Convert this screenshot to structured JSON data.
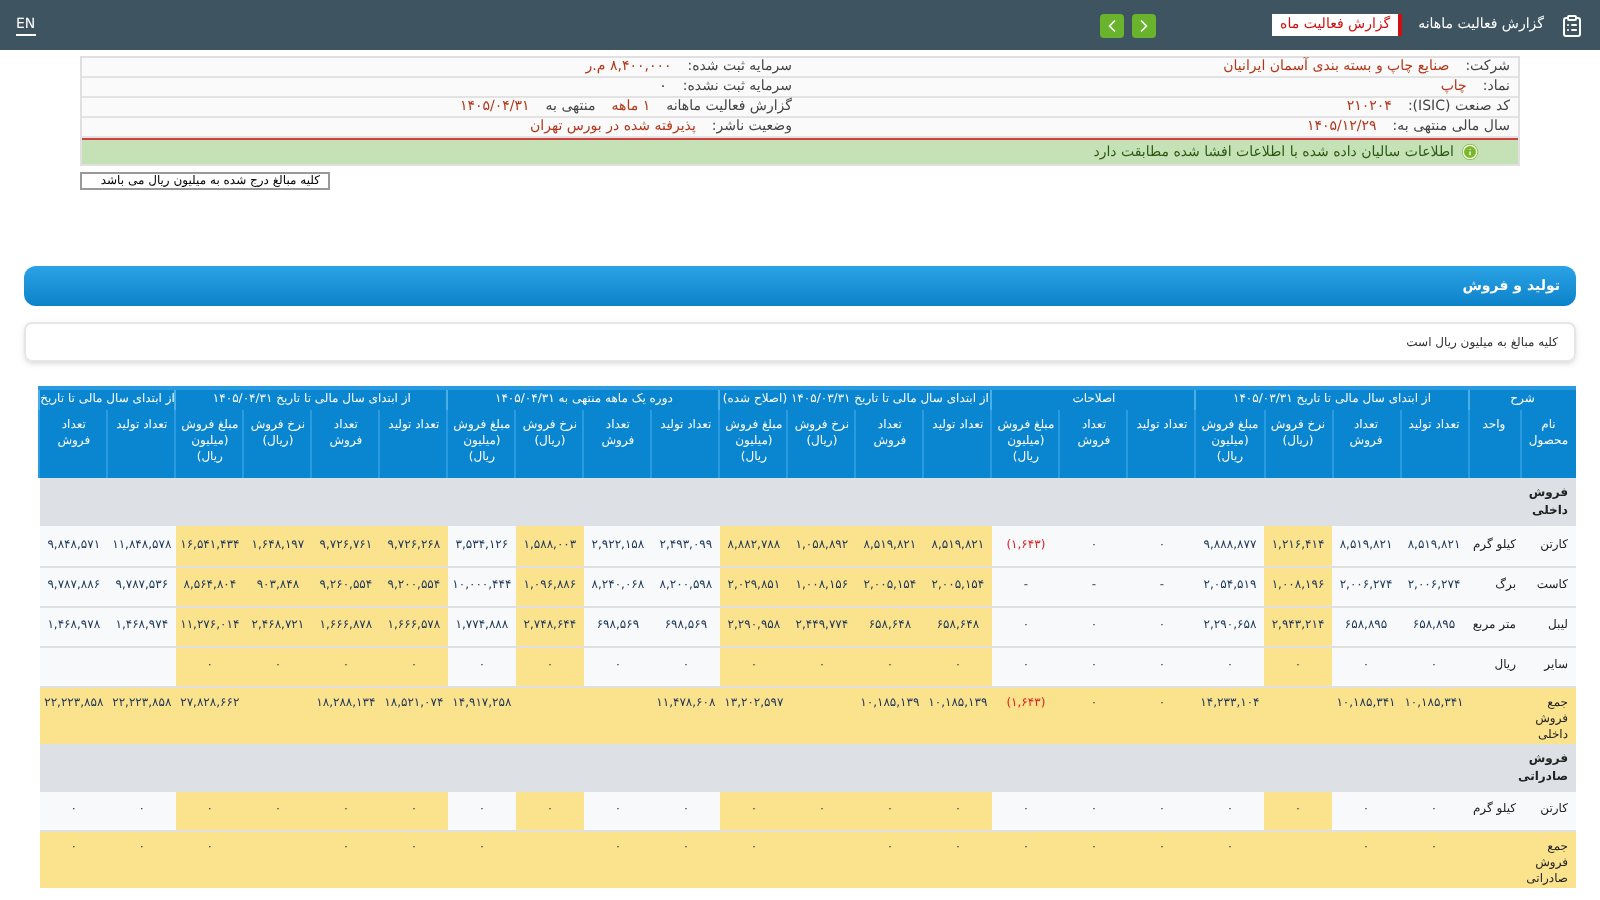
{
  "header": {
    "title": "گزارش فعالیت ماهانه",
    "badge": "گزارش فعالیت ماه",
    "language": "EN"
  },
  "info": {
    "right": [
      [
        {
          "kind": "label",
          "text": "شرکت:"
        },
        {
          "kind": "value",
          "text": "صنایع چاپ و بسته بندی آسمان ایرانیان"
        }
      ],
      [
        {
          "kind": "label",
          "text": "نماد:"
        },
        {
          "kind": "value",
          "text": "چاپ"
        }
      ],
      [
        {
          "kind": "label",
          "text": "کد صنعت (ISIC):"
        },
        {
          "kind": "value",
          "text": "۲۱۰۲۰۴"
        }
      ],
      [
        {
          "kind": "label",
          "text": "سال مالی منتهی به:"
        },
        {
          "kind": "value",
          "text": "۱۴۰۵/۱۲/۲۹"
        }
      ]
    ],
    "left": [
      [
        {
          "kind": "label",
          "text": "سرمایه ثبت شده:"
        },
        {
          "kind": "value",
          "text": "۸,۴۰۰,۰۰۰ م.ر"
        }
      ],
      [
        {
          "kind": "label",
          "text": "سرمایه ثبت نشده:"
        },
        {
          "kind": "plain",
          "text": "۰"
        }
      ],
      [
        {
          "kind": "label",
          "text": "گزارش فعالیت ماهانه"
        },
        {
          "kind": "value",
          "text": "۱ ماهه"
        },
        {
          "kind": "label",
          "text": "منتهی به"
        },
        {
          "kind": "value",
          "text": "۱۴۰۵/۰۴/۳۱"
        }
      ],
      [
        {
          "kind": "label",
          "text": "وضعیت ناشر:"
        },
        {
          "kind": "value",
          "text": "پذیرفته شده در بورس تهران"
        }
      ]
    ],
    "notice": "اطلاعات سالیان داده شده با اطلاعات افشا شده مطابقت دارد"
  },
  "unit_select": "کلیه مبالغ درج شده به میلیون ریال می باشد",
  "section": {
    "title": "تولید و فروش",
    "note": "کلیه مبالغ به میلیون ریال است"
  },
  "table": {
    "groups": [
      {
        "label": "شرح",
        "columns": [
          {
            "label": "نام محصول"
          },
          {
            "label": "واحد"
          }
        ]
      },
      {
        "label": "از ابتدای سال مالی تا تاریخ ۱۴۰۵/۰۳/۳۱",
        "columns": [
          {
            "label": "تعداد تولید",
            "highlighted": false
          },
          {
            "label": "تعداد فروش",
            "highlighted": false
          },
          {
            "label": "نرخ فروش (ریال)",
            "highlighted": true
          },
          {
            "label": "مبلغ فروش (میلیون ریال)",
            "highlighted": false
          }
        ]
      },
      {
        "label": "اصلاحات",
        "columns": [
          {
            "label": "تعداد تولید",
            "highlighted": false
          },
          {
            "label": "تعداد فروش",
            "highlighted": false
          },
          {
            "label": "مبلغ فروش (میلیون ریال)",
            "highlighted": false
          }
        ]
      },
      {
        "label": "از ابتدای سال مالی تا تاریخ ۱۴۰۵/۰۳/۳۱ (اصلاح شده)",
        "columns": [
          {
            "label": "تعداد تولید",
            "highlighted": true
          },
          {
            "label": "تعداد فروش",
            "highlighted": true
          },
          {
            "label": "نرخ فروش (ریال)",
            "highlighted": true
          },
          {
            "label": "مبلغ فروش (میلیون ریال)",
            "highlighted": true
          }
        ]
      },
      {
        "label": "دوره یک ماهه منتهی به ۱۴۰۵/۰۴/۳۱",
        "columns": [
          {
            "label": "تعداد تولید",
            "highlighted": false
          },
          {
            "label": "تعداد فروش",
            "highlighted": false
          },
          {
            "label": "نرخ فروش (ریال)",
            "highlighted": true
          },
          {
            "label": "مبلغ فروش (میلیون ریال)",
            "highlighted": false
          }
        ]
      },
      {
        "label": "از ابتدای سال مالی تا تاریخ ۱۴۰۵/۰۴/۳۱",
        "columns": [
          {
            "label": "تعداد تولید",
            "highlighted": true
          },
          {
            "label": "تعداد فروش",
            "highlighted": true
          },
          {
            "label": "نرخ فروش (ریال)",
            "highlighted": true
          },
          {
            "label": "مبلغ فروش (میلیون ریال)",
            "highlighted": true
          }
        ]
      },
      {
        "label": "از ابتدای سال مالی تا تاریخ",
        "columns": [
          {
            "label": "تعداد تولید",
            "highlighted": false
          },
          {
            "label": "تعداد فروش",
            "highlighted": false
          }
        ]
      }
    ],
    "rows": [
      {
        "kind": "group",
        "label": "فروش داخلی"
      },
      {
        "kind": "item",
        "name": "کارتن",
        "unit": "کیلو گرم",
        "cells": [
          "۸,۵۱۹,۸۲۱",
          "۸,۵۱۹,۸۲۱",
          "۱,۲۱۶,۴۱۴",
          "۹,۸۸۸,۸۷۷",
          "۰",
          "۰",
          {
            "text": "(۱,۶۴۳)",
            "negative": true
          },
          "۸,۵۱۹,۸۲۱",
          "۸,۵۱۹,۸۲۱",
          "۱,۰۵۸,۸۹۲",
          "۸,۸۸۲,۷۸۸",
          "۲,۴۹۳,۰۹۹",
          "۲,۹۲۲,۱۵۸",
          "۱,۵۸۸,۰۰۳",
          "۳,۵۳۴,۱۲۶",
          "۹,۷۲۶,۲۶۸",
          "۹,۷۲۶,۷۶۱",
          "۱,۶۴۸,۱۹۷",
          "۱۶,۵۴۱,۴۳۴",
          "۱۱,۸۴۸,۵۷۸",
          "۹,۸۴۸,۵۷۱"
        ]
      },
      {
        "kind": "item",
        "name": "کاست",
        "unit": "برگ",
        "cells": [
          "۲,۰۰۶,۲۷۴",
          "۲,۰۰۶,۲۷۴",
          "۱,۰۰۸,۱۹۶",
          "۲,۰۵۴,۵۱۹",
          "-",
          "-",
          "-",
          "۲,۰۰۵,۱۵۴",
          "۲,۰۰۵,۱۵۴",
          "۱,۰۰۸,۱۵۶",
          "۲,۰۲۹,۸۵۱",
          "۸,۲۰۰,۵۹۸",
          "۸,۲۴۰,۰۶۸",
          "۱,۰۹۶,۸۸۶",
          "۱۰,۰۰۰,۴۴۴",
          "۹,۲۰۰,۵۵۴",
          "۹,۲۶۰,۵۵۴",
          "۹۰۳,۸۴۸",
          "۸,۵۶۴,۸۰۴",
          "۹,۷۸۷,۵۳۶",
          "۹,۷۸۷,۸۸۶"
        ]
      },
      {
        "kind": "item",
        "name": "لیبل",
        "unit": "متر مربع",
        "cells": [
          "۶۵۸,۸۹۵",
          "۶۵۸,۸۹۵",
          "۲,۹۴۳,۲۱۴",
          "۲,۲۹۰,۶۵۸",
          "۰",
          "۰",
          "۰",
          "۶۵۸,۶۴۸",
          "۶۵۸,۶۴۸",
          "۲,۴۴۹,۷۷۴",
          "۲,۲۹۰,۹۵۸",
          "۶۹۸,۵۶۹",
          "۶۹۸,۵۶۹",
          "۲,۷۴۸,۶۴۴",
          "۱,۷۷۴,۸۸۸",
          "۱,۶۶۶,۵۷۸",
          "۱,۶۶۶,۸۷۸",
          "۲,۴۶۸,۷۲۱",
          "۱۱,۲۷۶,۰۱۴",
          "۱,۴۶۸,۹۷۴",
          "۱,۴۶۸,۹۷۸"
        ]
      },
      {
        "kind": "item",
        "name": "سایر",
        "unit": "ریال",
        "cells": [
          "۰",
          "۰",
          "۰",
          "۰",
          "۰",
          "۰",
          "۰",
          "۰",
          "۰",
          "۰",
          "۰",
          "۰",
          "۰",
          "۰",
          "۰",
          "۰",
          "۰",
          "۰",
          "۰",
          null,
          null
        ]
      },
      {
        "kind": "total",
        "label": "جمع فروش داخلی",
        "cells": [
          "۱۰,۱۸۵,۳۴۱",
          "۱۰,۱۸۵,۳۴۱",
          null,
          "۱۴,۲۳۳,۱۰۴",
          "۰",
          "۰",
          {
            "text": "(۱,۶۴۳)",
            "negative": true
          },
          "۱۰,۱۸۵,۱۳۹",
          "۱۰,۱۸۵,۱۳۹",
          null,
          "۱۳,۲۰۲,۵۹۷",
          "۱۱,۴۷۸,۶۰۸",
          null,
          null,
          "۱۴,۹۱۷,۲۵۸",
          "۱۸,۵۲۱,۰۷۴",
          "۱۸,۲۸۸,۱۳۴",
          null,
          "۲۷,۸۲۸,۶۶۲",
          "۲۲,۲۲۳,۸۵۸",
          "۲۲,۲۲۳,۸۵۸"
        ]
      },
      {
        "kind": "group",
        "label": "فروش صادراتی"
      },
      {
        "kind": "item",
        "name": "کارتن",
        "unit": "کیلو گرم",
        "cells": [
          "۰",
          "۰",
          "۰",
          "۰",
          "۰",
          "۰",
          "۰",
          "۰",
          "۰",
          "۰",
          "۰",
          "۰",
          "۰",
          "۰",
          "۰",
          "۰",
          "۰",
          "۰",
          "۰",
          "۰",
          "۰"
        ]
      },
      {
        "kind": "total",
        "label": "جمع فروش صادراتی",
        "cells": [
          "۰",
          "۰",
          null,
          "۰",
          "۰",
          "۰",
          "۰",
          "۰",
          "۰",
          null,
          "۰",
          "۰",
          "۰",
          null,
          "۰",
          "۰",
          "۰",
          null,
          "۰",
          "۰",
          "۰"
        ]
      }
    ]
  }
}
